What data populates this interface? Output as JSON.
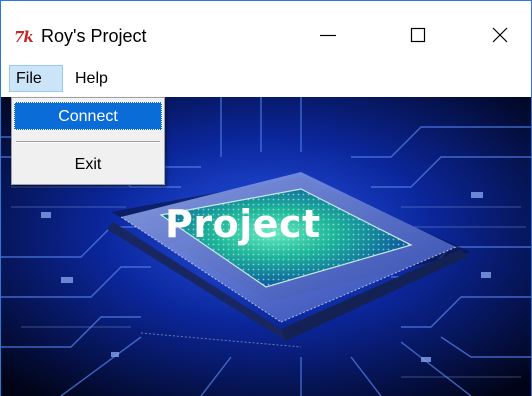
{
  "window": {
    "title": "Roy's Project",
    "app_icon_text": "7k",
    "icon": "tk-feather-icon",
    "controls": {
      "minimize": "minimize-icon",
      "maximize": "maximize-icon",
      "close": "close-icon"
    },
    "border_color": "#2a7ad5"
  },
  "menubar": {
    "items": [
      {
        "label": "File",
        "state": "open"
      },
      {
        "label": "Help"
      }
    ]
  },
  "file_menu": {
    "items": [
      {
        "label": "Connect",
        "state": "highlighted"
      },
      {
        "label": "Exit"
      }
    ],
    "highlight_color": "#0a6cd6"
  },
  "hero": {
    "title": "Project",
    "image": "circuit-board-chip-image"
  }
}
